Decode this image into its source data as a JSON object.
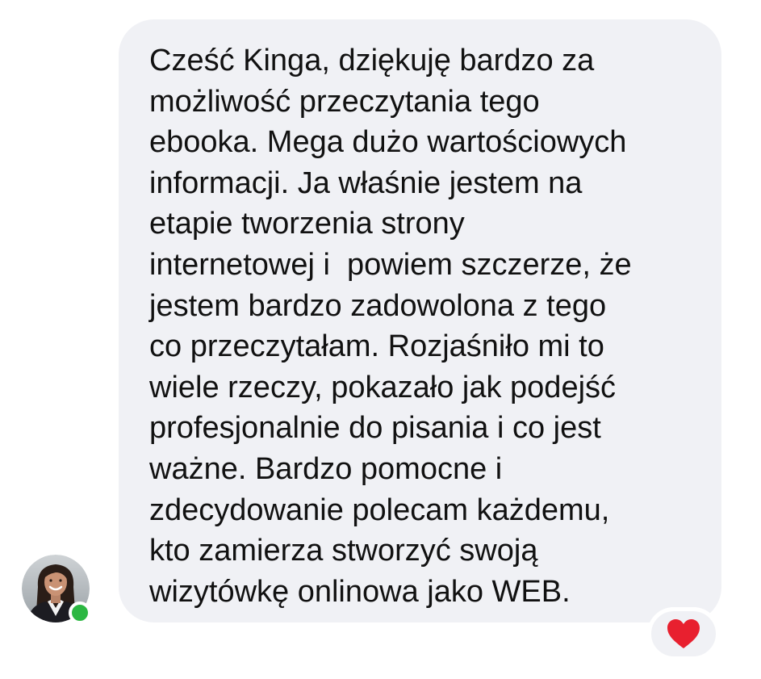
{
  "message": {
    "text": "Cześć Kinga, dziękuję bardzo za\nmożliwość przeczytania tego\nebooka. Mega dużo wartościowych\ninformacji. Ja właśnie jestem na\netapie tworzenia strony\ninternetowej i  powiem szczerze, że\njestem bardzo zadowolona z tego\nco przeczytałam. Rozjaśniło mi to\nwiele rzeczy, pokazało jak podejść\nprofesjonalnie do pisania i co jest\nważne. Bardzo pomocne i\nzdecydowanie polecam każdemu,\nkto zamierza stworzyć swoją\nwizytówkę onlinowa jako WEB."
  },
  "sender": {
    "avatar_icon": "avatar-photo",
    "online_status": "online"
  },
  "reaction": {
    "icon": "heart-icon"
  },
  "colors": {
    "bubble_bg": "#f0f1f5",
    "text": "#111111",
    "online_dot": "#2cb742",
    "heart": "#e8202f"
  }
}
